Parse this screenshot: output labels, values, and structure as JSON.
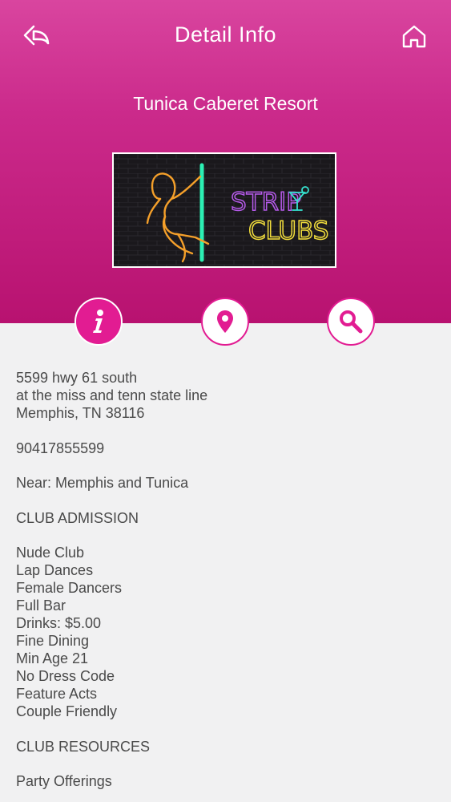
{
  "nav": {
    "title": "Detail Info",
    "back_icon": "back-arrow-icon",
    "home_icon": "home-icon"
  },
  "venue": {
    "name": "Tunica Caberet Resort"
  },
  "banner": {
    "line1": "STRIP",
    "line2": "CLUBS"
  },
  "actions": [
    {
      "icon": "info-icon",
      "active": true
    },
    {
      "icon": "map-pin-icon",
      "active": false
    },
    {
      "icon": "search-icon",
      "active": false
    }
  ],
  "details": {
    "address": [
      "5599 hwy 61 south",
      "at the miss and tenn state line",
      "Memphis, TN 38116"
    ],
    "phone": "90417855599",
    "near": "Near: Memphis and Tunica",
    "admission_heading": "CLUB ADMISSION",
    "features": [
      "Nude Club",
      "Lap Dances",
      "Female Dancers",
      "Full Bar",
      "Drinks: $5.00",
      "Fine Dining",
      "Min Age 21",
      "No Dress Code",
      "Feature Acts",
      "Couple Friendly"
    ],
    "resources_heading": "CLUB RESOURCES",
    "resources": [
      "Party Offerings"
    ]
  },
  "colors": {
    "header_top": "#d9459f",
    "header_bottom": "#b81270",
    "accent": "#e21c92",
    "text": "#4a4a4a",
    "background": "#f1f1f2"
  }
}
